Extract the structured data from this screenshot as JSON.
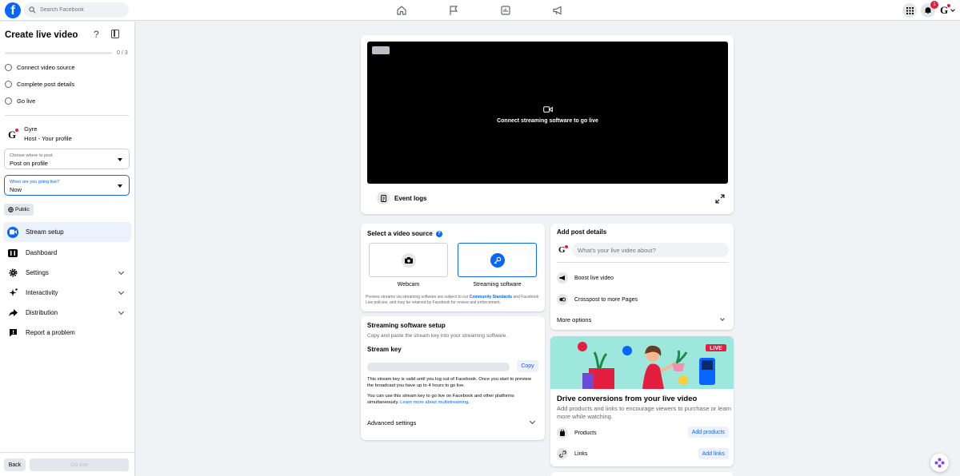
{
  "topbar": {
    "logo": "f",
    "search_placeholder": "Search Facebook",
    "notification_count": "1",
    "profile_initial": "G"
  },
  "sidebar": {
    "title": "Create live video",
    "help": "?",
    "progress_label": "0 / 3",
    "progress_fraction": 0,
    "steps": [
      "Connect video source",
      "Complete post details",
      "Go live"
    ],
    "host": {
      "initial": "G",
      "name": "Gyre",
      "role": "Host - Your profile"
    },
    "post_where": {
      "label": "Choose where to post",
      "value": "Post on profile"
    },
    "go_live_when": {
      "label": "When are you going live?",
      "value": "Now"
    },
    "audience": "Public",
    "menu": [
      {
        "label": "Stream setup",
        "icon": "video-camera-icon"
      },
      {
        "label": "Dashboard",
        "icon": "dashboard-icon"
      },
      {
        "label": "Settings",
        "icon": "gear-icon"
      },
      {
        "label": "Interactivity",
        "icon": "sparkle-icon"
      },
      {
        "label": "Distribution",
        "icon": "share-icon"
      },
      {
        "label": "Report a problem",
        "icon": "report-icon"
      }
    ],
    "back_label": "Back",
    "go_live_label": "Go live"
  },
  "preview": {
    "message": "Connect streaming software to go live",
    "event_logs": "Event logs"
  },
  "video_source": {
    "title": "Select a video source",
    "options": [
      "Webcam",
      "Streaming software"
    ],
    "fine_print_pre": "Preview streams via streaming software are subject to our ",
    "fine_print_link": "Community Standards",
    "fine_print_post": " and Facebook Live policies, and may be retained by Facebook for review and enforcement."
  },
  "streaming_setup": {
    "title": "Streaming software setup",
    "subtitle": "Copy and paste the stream key into your streaming software.",
    "key_label": "Stream key",
    "copy_label": "Copy",
    "note1": "This stream key is valid until you log out of Facebook. Once you start to preview the broadcast you have up to 4 hours to go live.",
    "note2_pre": "You can use this stream key to go live on Facebook and other platforms simultaneously. ",
    "note2_link": "Learn more about multistreaming",
    "note2_post": ".",
    "advanced": "Advanced settings"
  },
  "post_details": {
    "title": "Add post details",
    "input_placeholder": "What's your live video about?",
    "boost": "Boost live video",
    "crosspost": "Crosspost to more Pages",
    "more_options": "More options"
  },
  "promo": {
    "live_badge": "LIVE",
    "title": "Drive conversions from your live video",
    "description": "Add products and links to encourage viewers to purchase or learn more while watching.",
    "products_label": "Products",
    "add_products": "Add products",
    "links_label": "Links",
    "add_links": "Add links"
  },
  "colors": {
    "brand": "#0866ff",
    "background": "#f0f2f5",
    "notification": "#e41e3f"
  }
}
